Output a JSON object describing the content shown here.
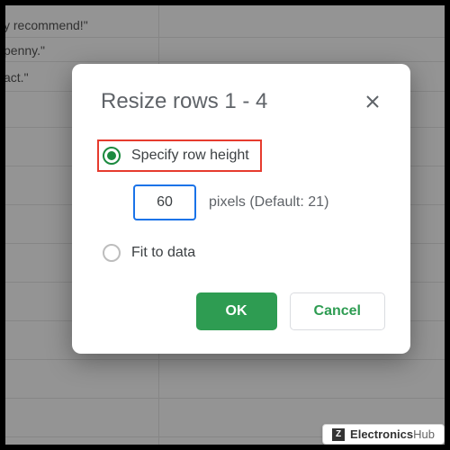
{
  "background": {
    "cells": [
      "y recommend!\"",
      "penny.\"",
      "act.\""
    ]
  },
  "dialog": {
    "title": "Resize rows 1 - 4",
    "option_specify": "Specify row height",
    "option_fit": "Fit to data",
    "input_value": "60",
    "pixels_label": "pixels (Default: 21)",
    "ok_label": "OK",
    "cancel_label": "Cancel"
  },
  "watermark": {
    "icon_letter": "Z",
    "text_bold": "Electronics",
    "text_light": "Hub"
  }
}
